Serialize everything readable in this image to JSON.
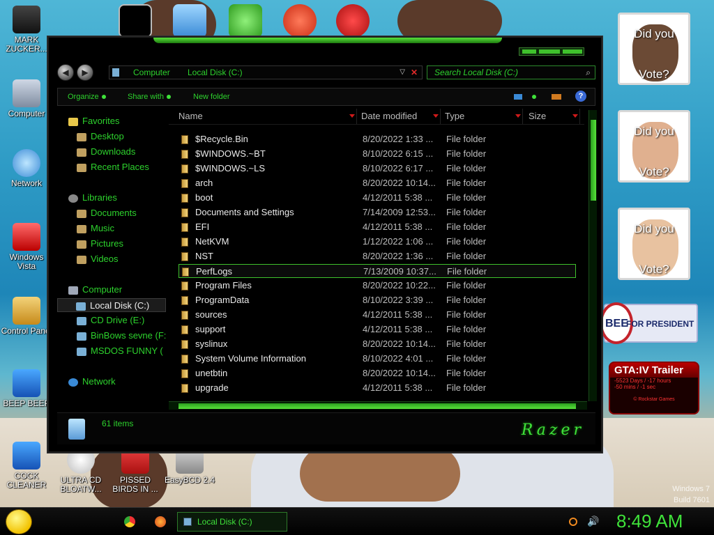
{
  "desktop": {
    "icons": [
      {
        "label": "MARK ZUCKER..."
      },
      {
        "label": "Computer"
      },
      {
        "label": "Network"
      },
      {
        "label": "Windows Vista"
      },
      {
        "label": "Control Panel"
      },
      {
        "label": "BEEP BEEP"
      },
      {
        "label": "COCK CLEANER"
      },
      {
        "label": "ULTRA CD BLOATW..."
      },
      {
        "label": "PISSED BIRDS IN ..."
      },
      {
        "label": "EasyBCD 2.4"
      }
    ],
    "top_icons": [
      {
        "label": "cmd",
        "color": "#000000"
      },
      {
        "label": "folders",
        "color": "#3a8ad6"
      },
      {
        "label": "bad piggies",
        "color": "#3fbf2e"
      },
      {
        "label": "P",
        "color": "#e03a22"
      },
      {
        "label": "DEV C++",
        "color": "#c81b1b"
      }
    ],
    "watermark_line1": "Windows 7",
    "watermark_line2": "Build 7601"
  },
  "widgets": {
    "vote_question_top": "Did you",
    "vote_question_bottom": "Vote?",
    "huckabee_bee": "BEE",
    "huckabee_text": "FOR PRESIDENT",
    "gta_title": "GTA:IV Trailer",
    "gta_line1": "-5523 Days / -17 hours",
    "gta_line2": "-50 mins / -1 sec",
    "gta_footer": "© Rockstar Games"
  },
  "explorer": {
    "address": {
      "crumb1": "Computer",
      "crumb2": "Local Disk (C:)"
    },
    "search_placeholder": "Search Local Disk (C:)",
    "toolbar": {
      "organize": "Organize",
      "share_with": "Share with",
      "new_folder": "New folder",
      "help": "?"
    },
    "nav": {
      "favorites": "Favorites",
      "desktop": "Desktop",
      "downloads": "Downloads",
      "recent_places": "Recent Places",
      "libraries": "Libraries",
      "documents": "Documents",
      "music": "Music",
      "pictures": "Pictures",
      "videos": "Videos",
      "computer": "Computer",
      "local_disk": "Local Disk (C:)",
      "cd_drive": "CD Drive (E:)",
      "binbows": "BinBows sevne (F:",
      "msdos": "MSDOS FUNNY (",
      "network": "Network"
    },
    "columns": {
      "name": "Name",
      "date_modified": "Date modified",
      "type": "Type",
      "size": "Size"
    },
    "files": [
      {
        "name": "$Recycle.Bin",
        "date": "8/20/2022 1:33 ...",
        "type": "File folder"
      },
      {
        "name": "$WINDOWS.~BT",
        "date": "8/10/2022 6:15 ...",
        "type": "File folder"
      },
      {
        "name": "$WINDOWS.~LS",
        "date": "8/10/2022 6:17 ...",
        "type": "File folder"
      },
      {
        "name": "arch",
        "date": "8/20/2022 10:14...",
        "type": "File folder"
      },
      {
        "name": "boot",
        "date": "4/12/2011 5:38 ...",
        "type": "File folder"
      },
      {
        "name": "Documents and Settings",
        "date": "7/14/2009 12:53...",
        "type": "File folder"
      },
      {
        "name": "EFI",
        "date": "4/12/2011 5:38 ...",
        "type": "File folder"
      },
      {
        "name": "NetKVM",
        "date": "1/12/2022 1:06 ...",
        "type": "File folder"
      },
      {
        "name": "NST",
        "date": "8/20/2022 1:36 ...",
        "type": "File folder"
      },
      {
        "name": "PerfLogs",
        "date": "7/13/2009 10:37...",
        "type": "File folder"
      },
      {
        "name": "Program Files",
        "date": "8/20/2022 10:22...",
        "type": "File folder"
      },
      {
        "name": "ProgramData",
        "date": "8/10/2022 3:39 ...",
        "type": "File folder"
      },
      {
        "name": "sources",
        "date": "4/12/2011 5:38 ...",
        "type": "File folder"
      },
      {
        "name": "support",
        "date": "4/12/2011 5:38 ...",
        "type": "File folder"
      },
      {
        "name": "syslinux",
        "date": "8/20/2022 10:14...",
        "type": "File folder"
      },
      {
        "name": "System Volume Information",
        "date": "8/10/2022 4:01 ...",
        "type": "File folder"
      },
      {
        "name": "unetbtin",
        "date": "8/20/2022 10:14...",
        "type": "File folder"
      },
      {
        "name": "upgrade",
        "date": "4/12/2011 5:38 ...",
        "type": "File folder"
      }
    ],
    "selected_index": 9,
    "status_count": "61 items",
    "brand": "Razer"
  },
  "taskbar": {
    "task_label": "Local Disk (C:)",
    "clock": "8:49 AM"
  },
  "colors": {
    "accent_green": "#3fe23a",
    "text_green": "#2dd22d"
  }
}
